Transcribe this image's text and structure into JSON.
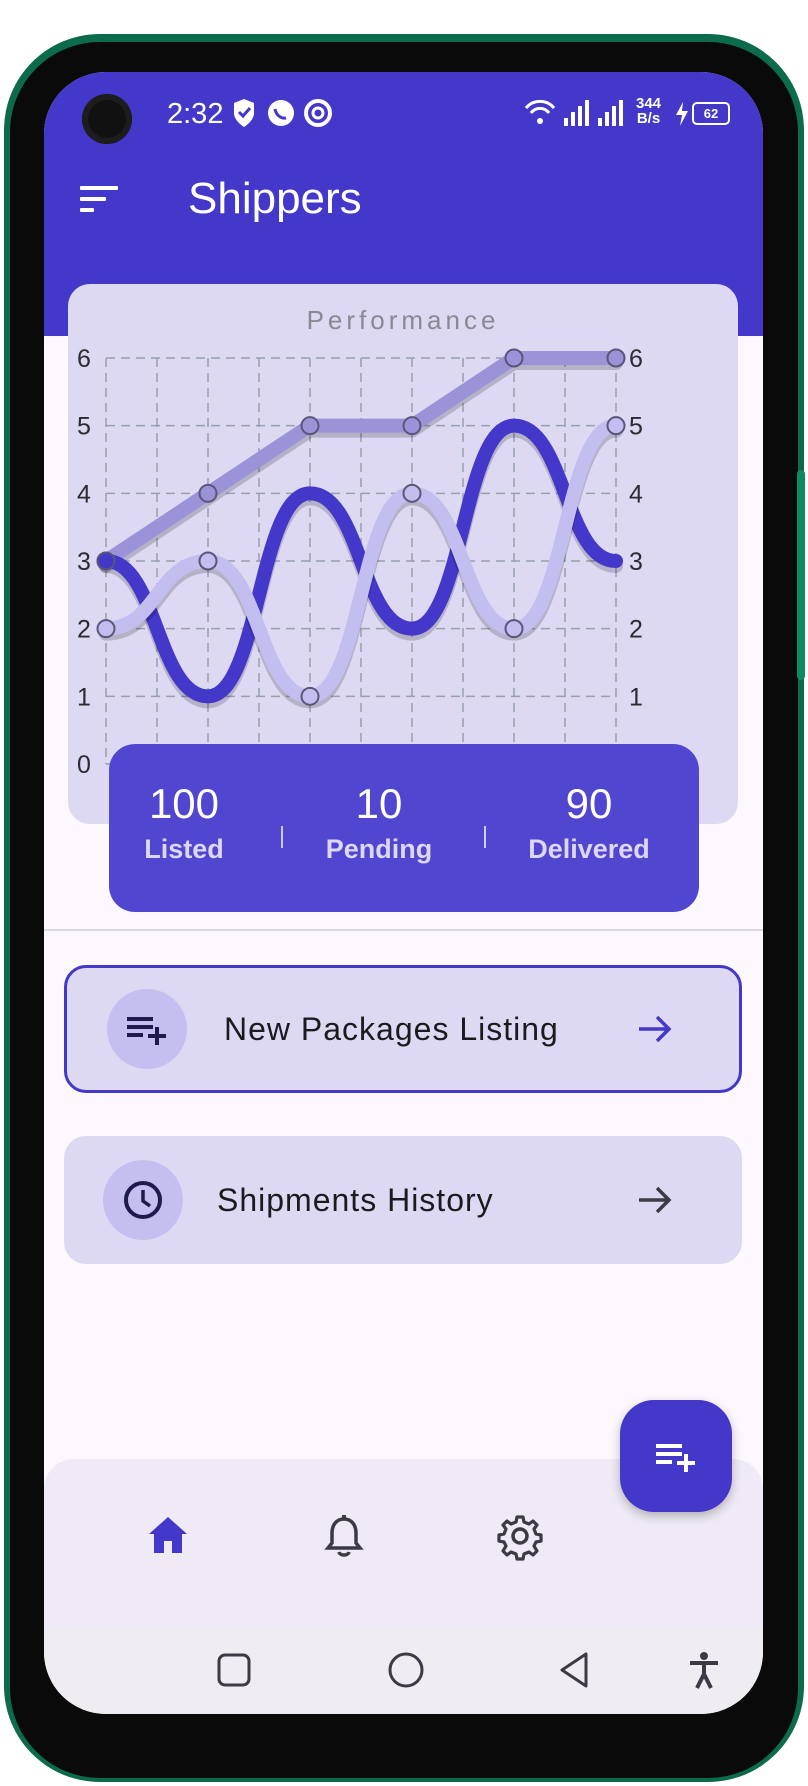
{
  "status_bar": {
    "time": "2:32",
    "network_speed": "344",
    "network_unit": "B/s",
    "battery": "62"
  },
  "app_bar": {
    "title": "Shippers",
    "menu_icon": "sort-menu-icon"
  },
  "chart_data": {
    "type": "line",
    "title": "Performance",
    "x": [
      0,
      1,
      2,
      3,
      4,
      5
    ],
    "ylim": [
      0,
      6
    ],
    "yticks": [
      "0",
      "1",
      "2",
      "3",
      "4",
      "5",
      "6"
    ],
    "grid": true,
    "series": [
      {
        "values": [
          3,
          4,
          5,
          5,
          6,
          6
        ],
        "color": "#9a93d8"
      },
      {
        "values": [
          3,
          1,
          4,
          2,
          5,
          3
        ],
        "color": "#4338c9"
      },
      {
        "values": [
          2,
          3,
          1,
          4,
          2,
          5
        ],
        "color": "#c3bef0"
      }
    ]
  },
  "stats": [
    {
      "value": "100",
      "label": "Listed"
    },
    {
      "value": "10",
      "label": "Pending"
    },
    {
      "value": "90",
      "label": "Delivered"
    }
  ],
  "actions": [
    {
      "label": "New Packages Listing",
      "icon": "playlist-add-icon"
    },
    {
      "label": "Shipments History",
      "icon": "clock-icon"
    }
  ],
  "fab": {
    "icon": "playlist-add-icon"
  },
  "bottom_nav": [
    {
      "name": "home",
      "icon": "home-icon",
      "active": true
    },
    {
      "name": "notifications",
      "icon": "bell-icon",
      "active": false
    },
    {
      "name": "settings",
      "icon": "gear-icon",
      "active": false
    }
  ],
  "colors": {
    "primary": "#4338c9",
    "surface": "#ddd9f3",
    "background": "#fcf8fe"
  }
}
